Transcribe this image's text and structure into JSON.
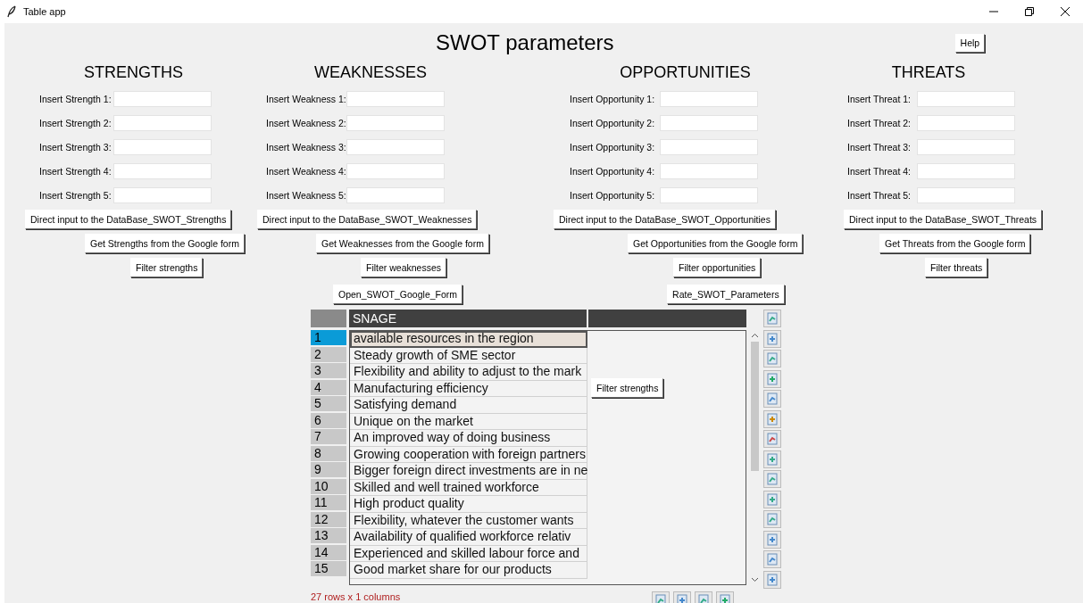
{
  "window": {
    "title": "Table app"
  },
  "title": "SWOT parameters",
  "help_button": "Help",
  "sections": [
    {
      "heading": "STRENGTHS",
      "inputs": [
        {
          "label": "Insert Strength 1:"
        },
        {
          "label": "Insert Strength 2:"
        },
        {
          "label": "Insert Strength 3:"
        },
        {
          "label": "Insert Strength 4:"
        },
        {
          "label": "Insert Strength 5:"
        }
      ],
      "buttons": [
        "Direct input to the DataBase_SWOT_Strengths",
        "Get Strengths from the Google form",
        "Filter strengths"
      ]
    },
    {
      "heading": "WEAKNESSES",
      "inputs": [
        {
          "label": "Insert Weakness 1:"
        },
        {
          "label": "Insert Weakness 2:"
        },
        {
          "label": "Insert Weakness 3:"
        },
        {
          "label": "Insert Weakness 4:"
        },
        {
          "label": "Insert Weakness 5:"
        }
      ],
      "buttons": [
        "Direct input to the DataBase_SWOT_Weaknesses",
        "Get Weaknesses from the Google form",
        "Filter weaknesses"
      ]
    },
    {
      "heading": "OPPORTUNITIES",
      "inputs": [
        {
          "label": "Insert Opportunity 1:"
        },
        {
          "label": "Insert Opportunity 2:"
        },
        {
          "label": "Insert Opportunity 3:"
        },
        {
          "label": "Insert Opportunity 4:"
        },
        {
          "label": "Insert Opportunity 5:"
        }
      ],
      "buttons": [
        "Direct input to the DataBase_SWOT_Opportunities",
        "Get Opportunities from the Google form",
        "Filter opportunities"
      ]
    },
    {
      "heading": "THREATS",
      "inputs": [
        {
          "label": "Insert Threat 1:"
        },
        {
          "label": "Insert Threat 2:"
        },
        {
          "label": "Insert Threat 3:"
        },
        {
          "label": "Insert Threat 4:"
        },
        {
          "label": "Insert Threat 5:"
        }
      ],
      "buttons": [
        "Direct input to the DataBase_SWOT_Threats",
        "Get Threats from the Google form",
        "Filter threats"
      ]
    }
  ],
  "actions": [
    "Open_SWOT_Google_Form",
    "Rate_SWOT_Parameters"
  ],
  "table": {
    "columns": [
      "SNAGE"
    ],
    "rows": [
      {
        "index": "1",
        "value": "available resources in the region",
        "selected": true
      },
      {
        "index": "2",
        "value": "Steady growth of SME sector",
        "selected": false
      },
      {
        "index": "3",
        "value": "Flexibility and ability to adjust to the mark",
        "selected": false
      },
      {
        "index": "4",
        "value": "Manufacturing efficiency",
        "selected": false
      },
      {
        "index": "5",
        "value": "Satisfying demand",
        "selected": false
      },
      {
        "index": "6",
        "value": "Unique on the market",
        "selected": false
      },
      {
        "index": "7",
        "value": "An improved way of doing business",
        "selected": false
      },
      {
        "index": "8",
        "value": "Growing cooperation with foreign partners",
        "selected": false
      },
      {
        "index": "9",
        "value": "Bigger foreign direct investments are in ne",
        "selected": false
      },
      {
        "index": "10",
        "value": "Skilled and well trained workforce",
        "selected": false
      },
      {
        "index": "11",
        "value": "High product quality",
        "selected": false
      },
      {
        "index": "12",
        "value": "Flexibility, whatever the customer wants",
        "selected": false
      },
      {
        "index": "13",
        "value": "Availability of qualified workforce relativ",
        "selected": false
      },
      {
        "index": "14",
        "value": "Experienced and skilled labour force and",
        "selected": false
      },
      {
        "index": "15",
        "value": "Good market share for our products",
        "selected": false
      }
    ]
  },
  "floating_button": "Filter strengths",
  "status_bar": "27 rows x 1 columns"
}
